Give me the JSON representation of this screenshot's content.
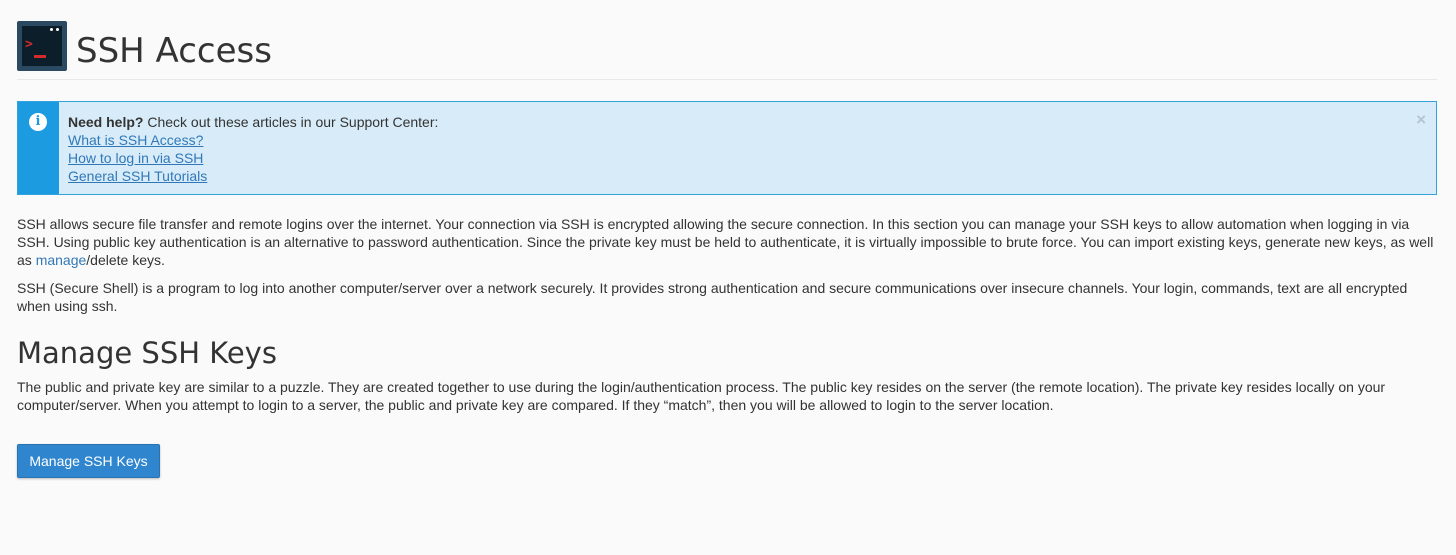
{
  "header": {
    "title": "SSH Access",
    "icon": "terminal-icon"
  },
  "help": {
    "icon": "info-icon",
    "title": "Need help?",
    "intro": "Check out these articles in our Support Center:",
    "links": [
      "What is SSH Access?",
      "How to log in via SSH",
      "General SSH Tutorials"
    ],
    "close": "×"
  },
  "intro": {
    "p1_before_link": "SSH allows secure file transfer and remote logins over the internet. Your connection via SSH is encrypted allowing the secure connection. In this section you can manage your SSH keys to allow automation when logging in via SSH. Using public key authentication is an alternative to password authentication. Since the private key must be held to authenticate, it is virtually impossible to brute force. You can import existing keys, generate new keys, as well as ",
    "p1_link": "manage",
    "p1_after_link": "/delete keys.",
    "p2": "SSH (Secure Shell) is a program to log into another computer/server over a network securely. It provides strong authentication and secure communications over insecure channels. Your login, commands, text are all encrypted when using ssh."
  },
  "manage": {
    "title": "Manage SSH Keys",
    "description": "The public and private key are similar to a puzzle. They are created together to use during the login/authentication process. The public key resides on the server (the remote location). The private key resides locally on your computer/server. When you attempt to login to a server, the public and private key are compared. If they “match”, then you will be allowed to login to the server location.",
    "button_label": "Manage SSH Keys"
  },
  "colors": {
    "accent": "#2f86cf",
    "info_strip": "#1d9be0",
    "info_background": "#d7ecf8",
    "link": "#3178b9",
    "terminal_prompt": "#d32b2b"
  }
}
